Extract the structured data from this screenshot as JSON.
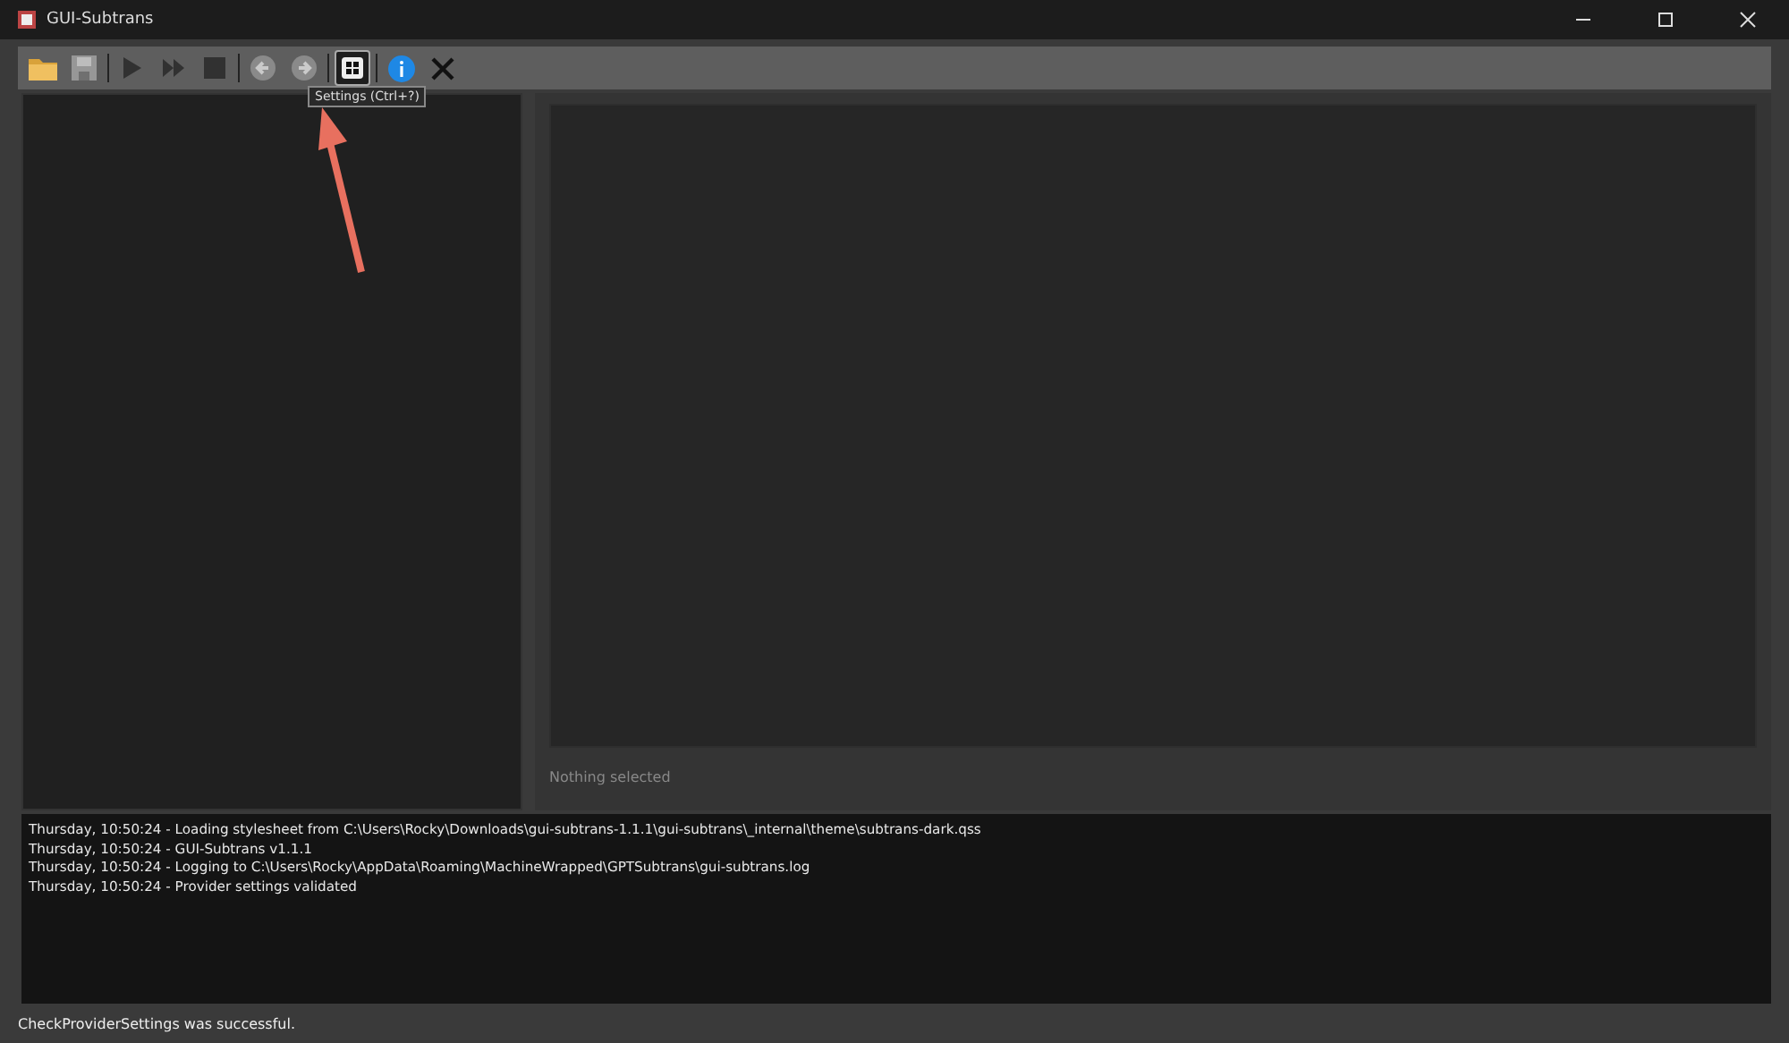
{
  "window": {
    "title": "GUI-Subtrans"
  },
  "toolbar": {
    "buttons": [
      {
        "kind": "open",
        "disabled": false,
        "selected": false
      },
      {
        "kind": "save",
        "disabled": true,
        "selected": false
      },
      {
        "kind": "sep"
      },
      {
        "kind": "play",
        "disabled": true,
        "selected": false
      },
      {
        "kind": "fastforward",
        "disabled": true,
        "selected": false
      },
      {
        "kind": "stop",
        "disabled": true,
        "selected": false
      },
      {
        "kind": "sep"
      },
      {
        "kind": "undo",
        "disabled": true,
        "selected": false
      },
      {
        "kind": "redo",
        "disabled": true,
        "selected": false
      },
      {
        "kind": "sep"
      },
      {
        "kind": "settings",
        "disabled": false,
        "selected": true
      },
      {
        "kind": "sep"
      },
      {
        "kind": "info",
        "disabled": false,
        "selected": false
      },
      {
        "kind": "tools",
        "disabled": false,
        "selected": false
      }
    ],
    "tooltip": "Settings (Ctrl+?)"
  },
  "detail": {
    "status": "Nothing selected"
  },
  "log": [
    "Thursday, 10:50:24 - Loading stylesheet from C:\\Users\\Rocky\\Downloads\\gui-subtrans-1.1.1\\gui-subtrans\\_internal\\theme\\subtrans-dark.qss",
    "Thursday, 10:50:24 - GUI-Subtrans v1.1.1",
    "Thursday, 10:50:24 - Logging to C:\\Users\\Rocky\\AppData\\Roaming\\MachineWrapped\\GPTSubtrans\\gui-subtrans.log",
    "Thursday, 10:50:24 - Provider settings validated"
  ],
  "status_bar": "CheckProviderSettings was successful."
}
